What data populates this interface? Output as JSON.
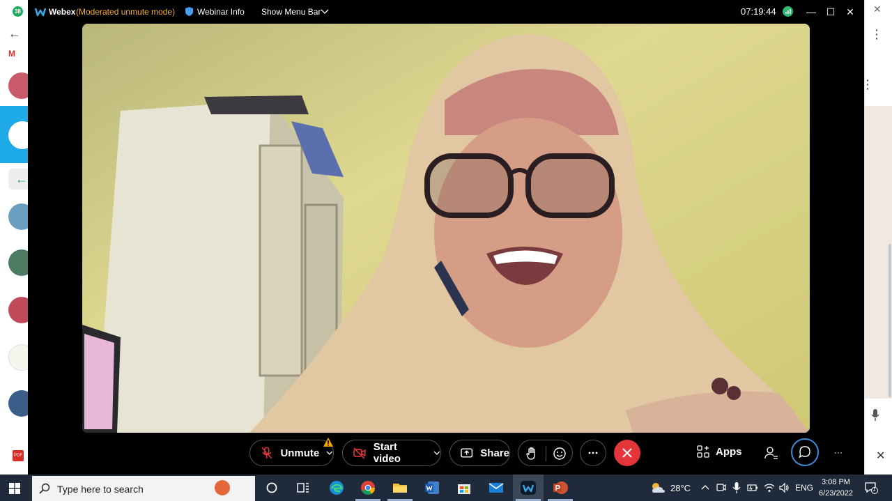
{
  "browser": {
    "tab_badge": "38"
  },
  "titlebar": {
    "app_name": "Webex",
    "mode": "(Moderated unmute mode)",
    "webinar_info": "Webinar Info",
    "show_menu": "Show Menu Bar",
    "elapsed_time": "07:19:44"
  },
  "controls": {
    "unmute_label": "Unmute",
    "start_video_label": "Start video",
    "share_label": "Share",
    "apps_label": "Apps"
  },
  "taskbar": {
    "search_placeholder": "Type here to search",
    "weather": "28°C",
    "language": "ENG",
    "time": "3:08 PM",
    "date": "6/23/2022",
    "notification_count": "1"
  },
  "colors": {
    "moderated_mode": "#f4b23a",
    "end_call": "#e4353b",
    "connection_ok": "#2eb872",
    "taskbar": "#1f2b3a"
  }
}
